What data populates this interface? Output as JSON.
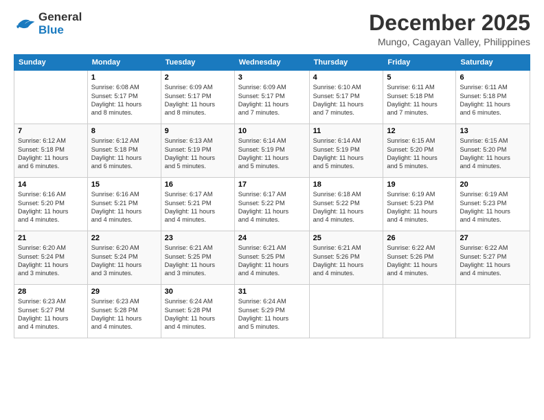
{
  "header": {
    "logo_line1": "General",
    "logo_line2": "Blue",
    "month": "December 2025",
    "location": "Mungo, Cagayan Valley, Philippines"
  },
  "columns": [
    "Sunday",
    "Monday",
    "Tuesday",
    "Wednesday",
    "Thursday",
    "Friday",
    "Saturday"
  ],
  "weeks": [
    [
      {
        "day": "",
        "info": ""
      },
      {
        "day": "1",
        "info": "Sunrise: 6:08 AM\nSunset: 5:17 PM\nDaylight: 11 hours\nand 8 minutes."
      },
      {
        "day": "2",
        "info": "Sunrise: 6:09 AM\nSunset: 5:17 PM\nDaylight: 11 hours\nand 8 minutes."
      },
      {
        "day": "3",
        "info": "Sunrise: 6:09 AM\nSunset: 5:17 PM\nDaylight: 11 hours\nand 7 minutes."
      },
      {
        "day": "4",
        "info": "Sunrise: 6:10 AM\nSunset: 5:17 PM\nDaylight: 11 hours\nand 7 minutes."
      },
      {
        "day": "5",
        "info": "Sunrise: 6:11 AM\nSunset: 5:18 PM\nDaylight: 11 hours\nand 7 minutes."
      },
      {
        "day": "6",
        "info": "Sunrise: 6:11 AM\nSunset: 5:18 PM\nDaylight: 11 hours\nand 6 minutes."
      }
    ],
    [
      {
        "day": "7",
        "info": "Sunrise: 6:12 AM\nSunset: 5:18 PM\nDaylight: 11 hours\nand 6 minutes."
      },
      {
        "day": "8",
        "info": "Sunrise: 6:12 AM\nSunset: 5:18 PM\nDaylight: 11 hours\nand 6 minutes."
      },
      {
        "day": "9",
        "info": "Sunrise: 6:13 AM\nSunset: 5:19 PM\nDaylight: 11 hours\nand 5 minutes."
      },
      {
        "day": "10",
        "info": "Sunrise: 6:14 AM\nSunset: 5:19 PM\nDaylight: 11 hours\nand 5 minutes."
      },
      {
        "day": "11",
        "info": "Sunrise: 6:14 AM\nSunset: 5:19 PM\nDaylight: 11 hours\nand 5 minutes."
      },
      {
        "day": "12",
        "info": "Sunrise: 6:15 AM\nSunset: 5:20 PM\nDaylight: 11 hours\nand 5 minutes."
      },
      {
        "day": "13",
        "info": "Sunrise: 6:15 AM\nSunset: 5:20 PM\nDaylight: 11 hours\nand 4 minutes."
      }
    ],
    [
      {
        "day": "14",
        "info": "Sunrise: 6:16 AM\nSunset: 5:20 PM\nDaylight: 11 hours\nand 4 minutes."
      },
      {
        "day": "15",
        "info": "Sunrise: 6:16 AM\nSunset: 5:21 PM\nDaylight: 11 hours\nand 4 minutes."
      },
      {
        "day": "16",
        "info": "Sunrise: 6:17 AM\nSunset: 5:21 PM\nDaylight: 11 hours\nand 4 minutes."
      },
      {
        "day": "17",
        "info": "Sunrise: 6:17 AM\nSunset: 5:22 PM\nDaylight: 11 hours\nand 4 minutes."
      },
      {
        "day": "18",
        "info": "Sunrise: 6:18 AM\nSunset: 5:22 PM\nDaylight: 11 hours\nand 4 minutes."
      },
      {
        "day": "19",
        "info": "Sunrise: 6:19 AM\nSunset: 5:23 PM\nDaylight: 11 hours\nand 4 minutes."
      },
      {
        "day": "20",
        "info": "Sunrise: 6:19 AM\nSunset: 5:23 PM\nDaylight: 11 hours\nand 4 minutes."
      }
    ],
    [
      {
        "day": "21",
        "info": "Sunrise: 6:20 AM\nSunset: 5:24 PM\nDaylight: 11 hours\nand 3 minutes."
      },
      {
        "day": "22",
        "info": "Sunrise: 6:20 AM\nSunset: 5:24 PM\nDaylight: 11 hours\nand 3 minutes."
      },
      {
        "day": "23",
        "info": "Sunrise: 6:21 AM\nSunset: 5:25 PM\nDaylight: 11 hours\nand 3 minutes."
      },
      {
        "day": "24",
        "info": "Sunrise: 6:21 AM\nSunset: 5:25 PM\nDaylight: 11 hours\nand 4 minutes."
      },
      {
        "day": "25",
        "info": "Sunrise: 6:21 AM\nSunset: 5:26 PM\nDaylight: 11 hours\nand 4 minutes."
      },
      {
        "day": "26",
        "info": "Sunrise: 6:22 AM\nSunset: 5:26 PM\nDaylight: 11 hours\nand 4 minutes."
      },
      {
        "day": "27",
        "info": "Sunrise: 6:22 AM\nSunset: 5:27 PM\nDaylight: 11 hours\nand 4 minutes."
      }
    ],
    [
      {
        "day": "28",
        "info": "Sunrise: 6:23 AM\nSunset: 5:27 PM\nDaylight: 11 hours\nand 4 minutes."
      },
      {
        "day": "29",
        "info": "Sunrise: 6:23 AM\nSunset: 5:28 PM\nDaylight: 11 hours\nand 4 minutes."
      },
      {
        "day": "30",
        "info": "Sunrise: 6:24 AM\nSunset: 5:28 PM\nDaylight: 11 hours\nand 4 minutes."
      },
      {
        "day": "31",
        "info": "Sunrise: 6:24 AM\nSunset: 5:29 PM\nDaylight: 11 hours\nand 5 minutes."
      },
      {
        "day": "",
        "info": ""
      },
      {
        "day": "",
        "info": ""
      },
      {
        "day": "",
        "info": ""
      }
    ]
  ]
}
